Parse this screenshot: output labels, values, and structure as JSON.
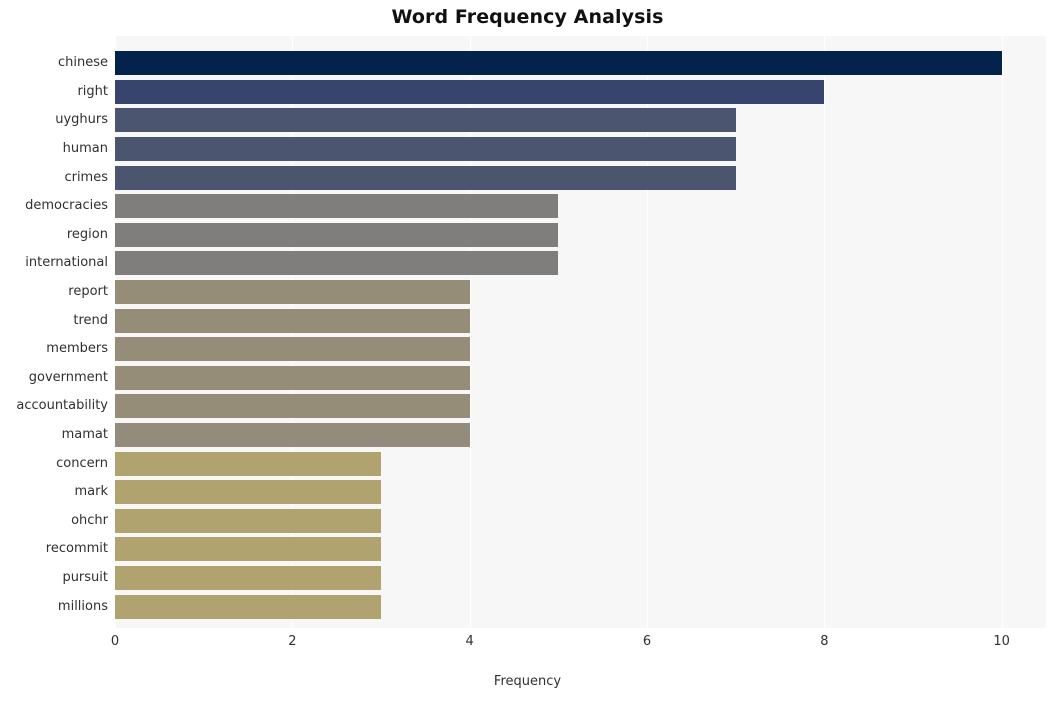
{
  "chart_data": {
    "type": "bar",
    "orientation": "horizontal",
    "title": "Word Frequency Analysis",
    "xlabel": "Frequency",
    "ylabel": "",
    "xlim": [
      0,
      10.5
    ],
    "xticks": [
      0,
      2,
      4,
      6,
      8,
      10
    ],
    "xticklabels": [
      "0",
      "2",
      "4",
      "6",
      "8",
      "10"
    ],
    "grid": "vertical-white",
    "legend": "none",
    "categories": [
      "chinese",
      "right",
      "uyghurs",
      "human",
      "crimes",
      "democracies",
      "region",
      "international",
      "report",
      "trend",
      "members",
      "government",
      "accountability",
      "mamat",
      "concern",
      "mark",
      "ohchr",
      "recommit",
      "pursuit",
      "millions"
    ],
    "values": [
      10,
      8,
      7,
      7,
      7,
      5,
      5,
      5,
      4,
      4,
      4,
      4,
      4,
      4,
      3,
      3,
      3,
      3,
      3,
      3
    ],
    "bar_colors": [
      "#04234c",
      "#37456e",
      "#4c5570",
      "#4c5570",
      "#4c5570",
      "#7f7e7c",
      "#7f7e7c",
      "#7f7e7c",
      "#958d77",
      "#958d77",
      "#958d77",
      "#958d77",
      "#958d77",
      "#938c7c",
      "#b0a36f",
      "#b0a36f",
      "#b0a36f",
      "#b0a36f",
      "#b0a36f",
      "#b0a36f"
    ]
  },
  "style": {
    "plot_background": "#f7f7f7",
    "page_background": "#ffffff",
    "gridline_color": "#ffffff",
    "text_color": "#303030",
    "title_color": "#111111"
  }
}
